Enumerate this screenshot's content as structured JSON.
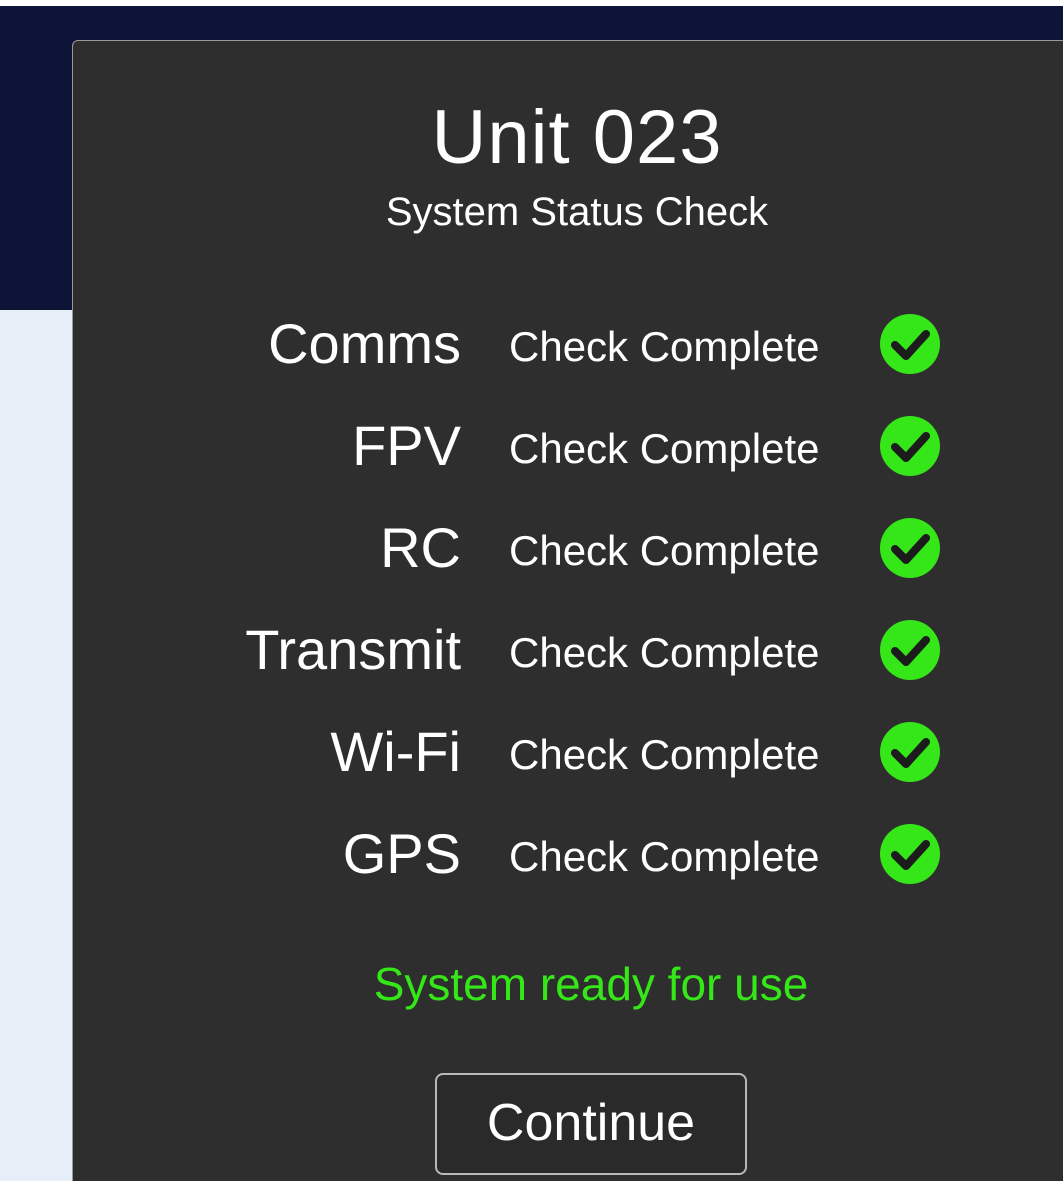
{
  "modal": {
    "title": "Unit 023",
    "subtitle": "System Status Check",
    "checks": [
      {
        "name": "Comms",
        "status": "Check Complete",
        "icon": "check-circle-icon"
      },
      {
        "name": "FPV",
        "status": "Check Complete",
        "icon": "check-circle-icon"
      },
      {
        "name": "RC",
        "status": "Check Complete",
        "icon": "check-circle-icon"
      },
      {
        "name": "Transmit",
        "status": "Check Complete",
        "icon": "check-circle-icon"
      },
      {
        "name": "Wi-Fi",
        "status": "Check Complete",
        "icon": "check-circle-icon"
      },
      {
        "name": "GPS",
        "status": "Check Complete",
        "icon": "check-circle-icon"
      }
    ],
    "ready_message": "System ready for use",
    "continue_label": "Continue"
  },
  "colors": {
    "background": "#e6eef7",
    "header_band": "#0e1438",
    "modal_bg": "#2e2e2e",
    "success": "#35e619",
    "text": "#ffffff"
  }
}
